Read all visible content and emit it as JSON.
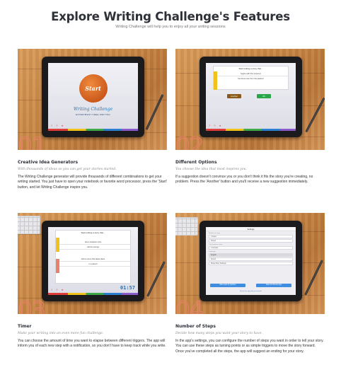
{
  "page": {
    "title": "Explore Writing Challenge's Features",
    "subtitle": "Writing Challenge will help you to enjoy all your writing sessions"
  },
  "features": [
    {
      "number": "01",
      "title": "Creative Idea Generators",
      "tagline": "With thousands of ideas so you can get your stories started.",
      "description": "The Writing Challenge generator will provide thousands of different combinations to get your writing started. You just have to open your notebook or favorite word processor, press the 'Start' button, and let Writing Challenge inspire you.",
      "screen": {
        "start_label": "Start",
        "logo": "Writing Challenge",
        "logo_sub": "EXPERIMENT FREE WRITING",
        "icons": "? ⏱ ★"
      }
    },
    {
      "number": "02",
      "title": "Different Options",
      "tagline": "You choose the idea that most inspires you.",
      "description": "If a suggestion doesn't convince you or you don't think it fits the story you're creating, no problem. Press the 'Another' button and you'll receive a new suggestion immediately.",
      "screen": {
        "header": "Start writing a story that...",
        "line1": "begins with this sentence",
        "line2": "'He threw rose from the jukebox'",
        "another_label": "Another",
        "ok_label": "OK",
        "icons": "? ⏱ ★"
      }
    },
    {
      "number": "03",
      "title": "Timer",
      "tagline": "Make your writing into an even more fun challenge.",
      "description": "You can choose the amount of time you want to elapse between different triggers. The app will inform you of each new step with a notification, so you don't have to keep track while you write.",
      "screen": {
        "header": "Start writing a story that...",
        "line1": "has a character who",
        "line2": "wants revenge",
        "line3": "Add a scene that takes place",
        "line4": "in a desert",
        "timer": "01:57",
        "icons": "? ⏱ ★"
      }
    },
    {
      "number": "04",
      "title": "Number of Steps",
      "tagline": "Decide how many steps you want your story to have.",
      "description": "In the app's settings, you can configure the number of steps you want in order to tell your story. You can use these steps as turning points or as simple triggers to move the story forward. Once you've completed all the steps, the app will suggest an ending for your story.",
      "screen": {
        "header": "Settings",
        "label1": "Number of steps",
        "row1": "3 steps",
        "row2": "Sound",
        "label2": "Time between steps",
        "row3": "3 minutes",
        "label3": "Language",
        "row4": "English",
        "row5": "Sound",
        "row6": "Show Story Settings",
        "btn1": "More apps by Quillcan",
        "btn2": "Rate and Review App",
        "footer": "Share this app with your friends"
      }
    }
  ],
  "colors": {
    "accent_number": "#e8806a",
    "start_orange": "#e0702c",
    "logo_blue": "#2c79b8",
    "side_yellow": "#f1c21b",
    "side_orange": "#e8806a",
    "another_brown": "#8a5a1a",
    "ok_green": "#2aa64a",
    "timer_blue": "#2e6fb3"
  }
}
